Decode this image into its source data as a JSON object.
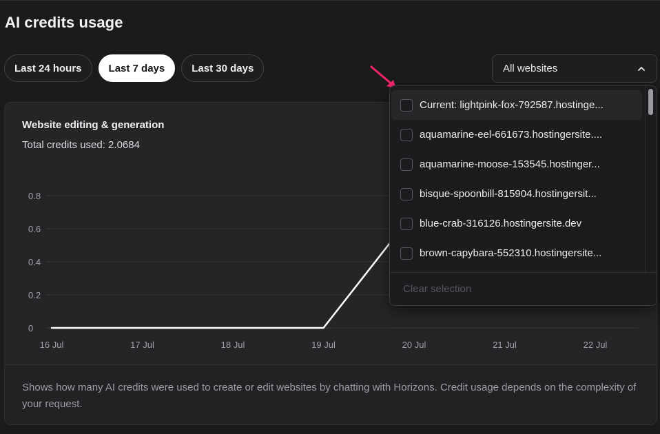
{
  "page": {
    "title": "AI credits usage"
  },
  "filters": {
    "periods": [
      {
        "label": "Last 24 hours",
        "active": false
      },
      {
        "label": "Last 7 days",
        "active": true
      },
      {
        "label": "Last 30 days",
        "active": false
      }
    ]
  },
  "site_select": {
    "value": "All websites",
    "icon": "chevron-up-icon"
  },
  "dropdown": {
    "items": [
      "Current: lightpink-fox-792587.hostinge...",
      "aquamarine-eel-661673.hostingersite....",
      "aquamarine-moose-153545.hostinger...",
      "bisque-spoonbill-815904.hostingersit...",
      "blue-crab-316126.hostingersite.dev",
      "brown-capybara-552310.hostingersite..."
    ],
    "clear_label": "Clear selection"
  },
  "card": {
    "title": "Website editing & generation",
    "subtitle": "Total credits used: 2.0684",
    "footer": "Shows how many AI credits were used to create or edit websites by chatting with Horizons. Credit usage depends on the complexity of your request."
  },
  "chart_data": {
    "type": "line",
    "x": [
      "16 Jul",
      "17 Jul",
      "18 Jul",
      "19 Jul",
      "20 Jul",
      "21 Jul",
      "22 Jul"
    ],
    "y_ticks": [
      0,
      0.2,
      0.4,
      0.6,
      0.8
    ],
    "series": [
      {
        "values": [
          0,
          0,
          0,
          0,
          0.7,
          null,
          null
        ]
      }
    ],
    "ylim": [
      0,
      0.8
    ],
    "grid": true,
    "line_color": "#ffffff"
  },
  "colors": {
    "annotation_arrow": "#f0256e"
  }
}
